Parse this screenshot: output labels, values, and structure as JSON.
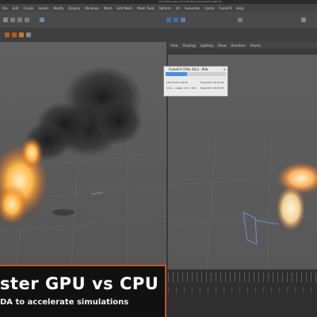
{
  "window": {
    "title": "x/fumeFX/Labels/_FumeFX/BoundDataset/fumeEF.mb"
  },
  "menubar": {
    "items": [
      "File",
      "Edit",
      "Create",
      "Select",
      "Modify",
      "Display",
      "Windows",
      "Mesh",
      "Edit Mesh",
      "Mesh Tools",
      "Deform",
      "UV",
      "Generate",
      "Cache",
      "FumeFX",
      "Help"
    ]
  },
  "viewport_right": {
    "menu": [
      "View",
      "Shading",
      "Lighting",
      "Show",
      "Renderer",
      "Panels"
    ]
  },
  "panel": {
    "title": "FumeFX CPUs 28.0 - 90b",
    "progress": 0.35,
    "rows": [
      {
        "label": "Last Frame: 99.0b",
        "value": "Expected: 00:00:18"
      },
      {
        "label": "Sims... usage: 12.1 / 90b",
        "value": "Expected: 00:00:18"
      }
    ]
  },
  "banner": {
    "headline": "ster GPU vs CPU",
    "subline": "DA to accelerate simulations"
  },
  "colors": {
    "accent": "#c9521a",
    "fire": "#ff9a2e",
    "smoke": "#222222"
  }
}
